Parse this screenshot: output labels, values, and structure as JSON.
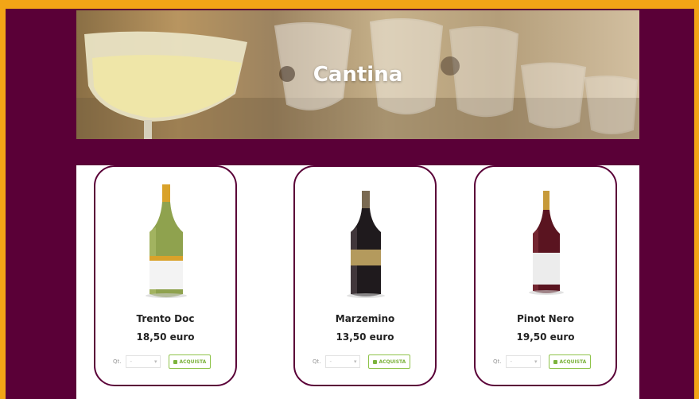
{
  "page": {
    "title": "Cantina"
  },
  "products": [
    {
      "name": "Trento Doc",
      "price": "18,50 euro",
      "qty_label": "Qt.",
      "qty_value": "-",
      "button_label": "ACQUISTA"
    },
    {
      "name": "Marzemino",
      "price": "13,50 euro",
      "qty_label": "Qt.",
      "qty_value": "-",
      "button_label": "ACQUISTA"
    },
    {
      "name": "Pinot Nero",
      "price": "19,50 euro",
      "qty_label": "Qt.",
      "qty_value": "-",
      "button_label": "ACQUISTA"
    }
  ],
  "colors": {
    "background": "#5a0037",
    "border": "#f2a516",
    "accent": "#7cb33c"
  }
}
